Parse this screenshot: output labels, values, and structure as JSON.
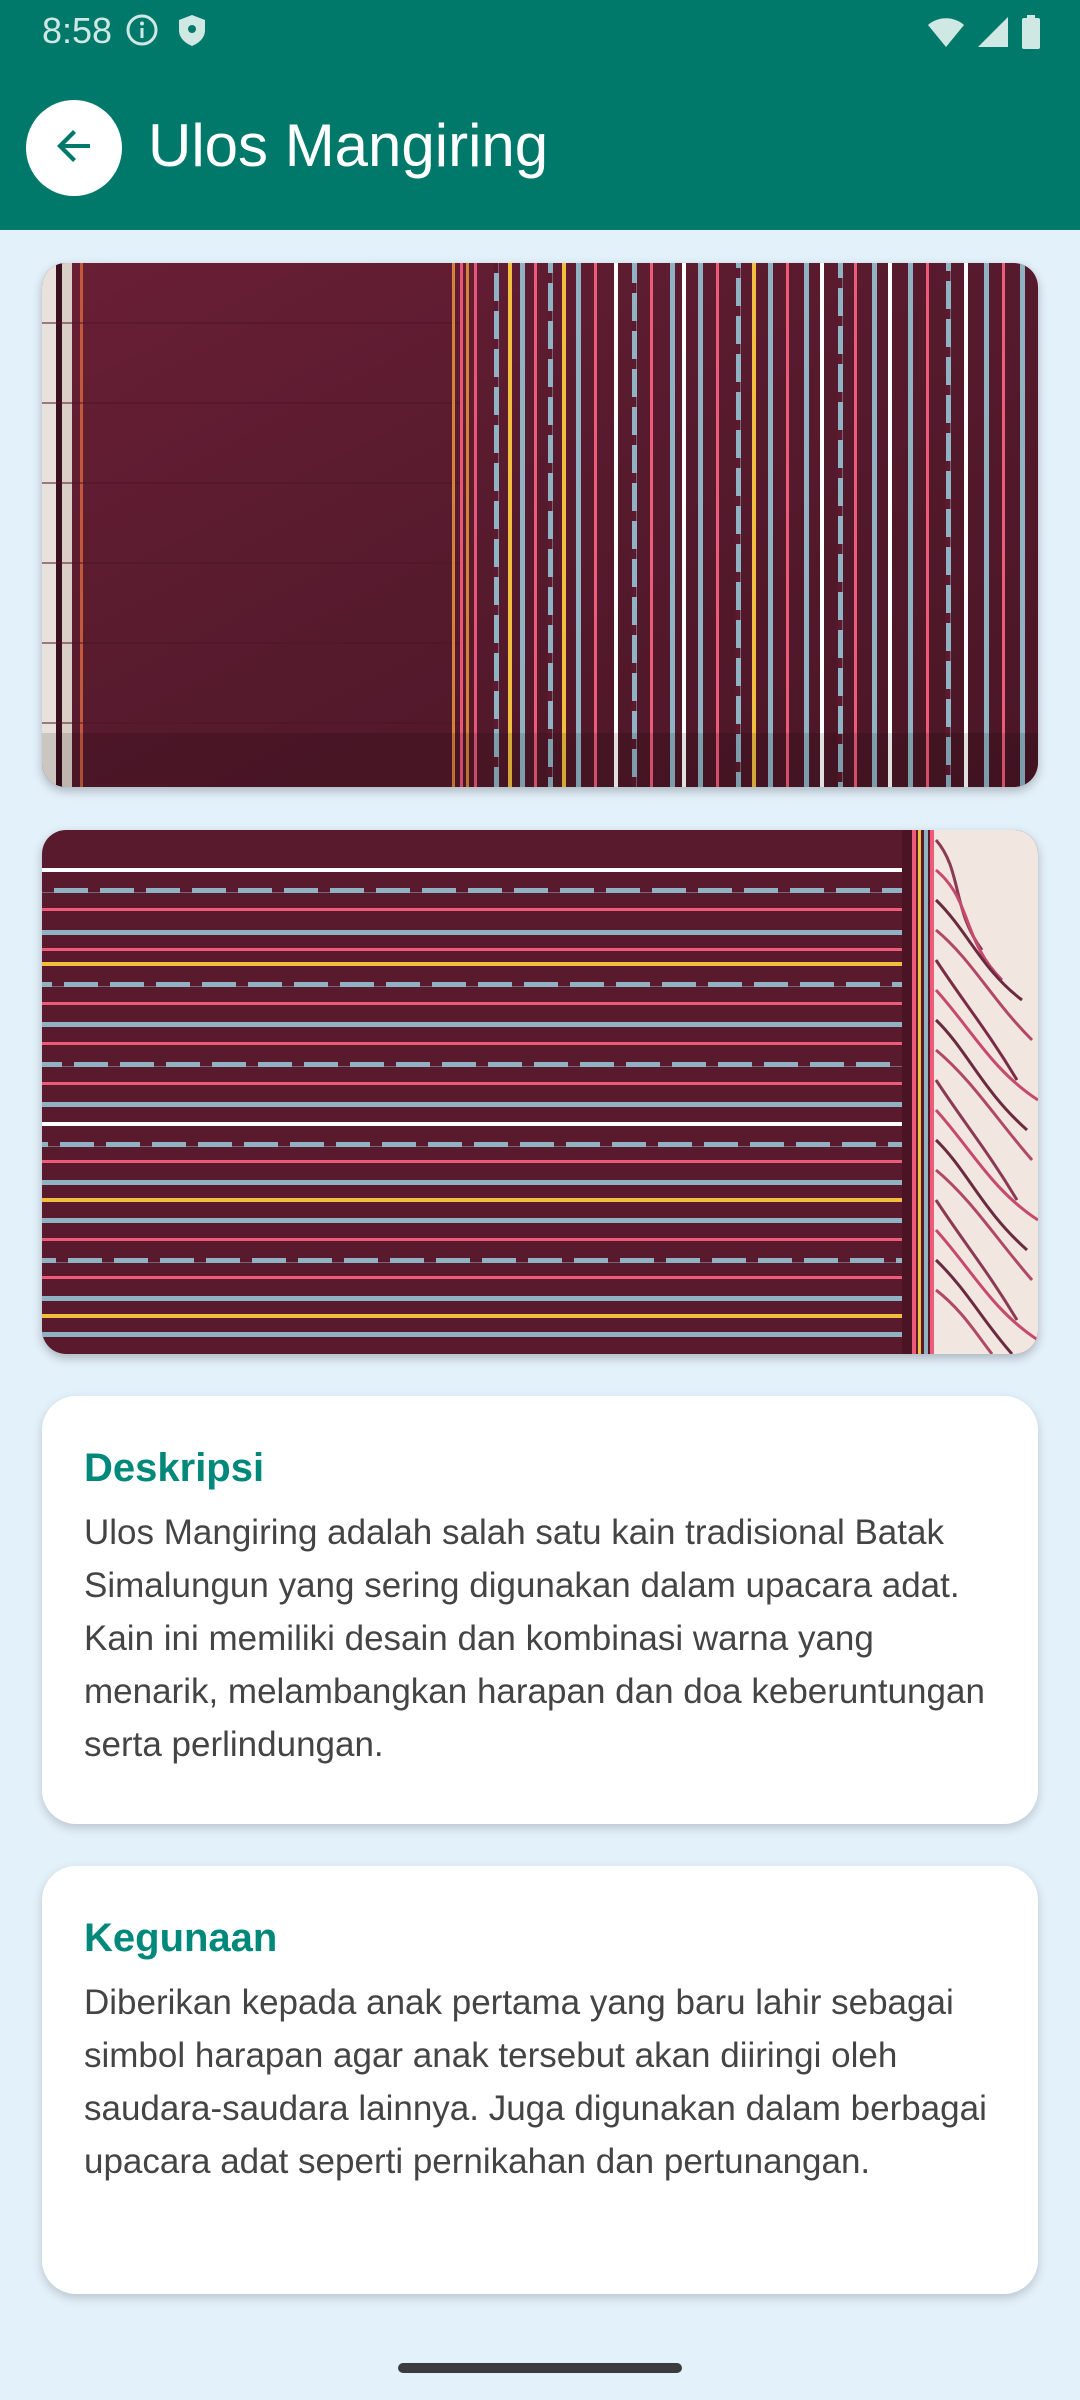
{
  "status_bar": {
    "time": "8:58",
    "icons_left": [
      "info-circle-icon",
      "shield-icon"
    ],
    "icons_right": [
      "wifi-icon",
      "signal-icon",
      "battery-icon"
    ]
  },
  "app_bar": {
    "title": "Ulos Mangiring",
    "back_icon": "arrow-left-icon",
    "colors": {
      "bar": "#00796b",
      "back_bg": "#ffffff"
    }
  },
  "images": [
    {
      "name": "ulos-photo-folded",
      "colors": [
        "#5c1a2e",
        "#ffffff",
        "#e84a63",
        "#f0b93a",
        "#7fa6b5"
      ]
    },
    {
      "name": "ulos-photo-fringe",
      "colors": [
        "#5c1a2e",
        "#ffffff",
        "#e84a63",
        "#f0b93a",
        "#7fa6b5"
      ]
    }
  ],
  "sections": {
    "description": {
      "heading": "Deskripsi",
      "body": "Ulos Mangiring adalah salah satu kain tradisional Batak Simalungun yang sering digunakan dalam upacara adat. Kain ini memiliki desain dan kombinasi warna yang menarik, melambangkan harapan dan doa keberuntungan serta perlindungan."
    },
    "usage": {
      "heading": "Kegunaan",
      "body": "Diberikan kepada anak pertama yang baru lahir sebagai simbol harapan agar anak tersebut akan diiringi oleh saudara-saudara lainnya. Juga digunakan dalam berbagai upacara adat seperti pernikahan dan pertunangan."
    }
  },
  "theme": {
    "background": "#e3f1fb",
    "heading_color": "#00897b",
    "body_text_color": "#444444"
  }
}
